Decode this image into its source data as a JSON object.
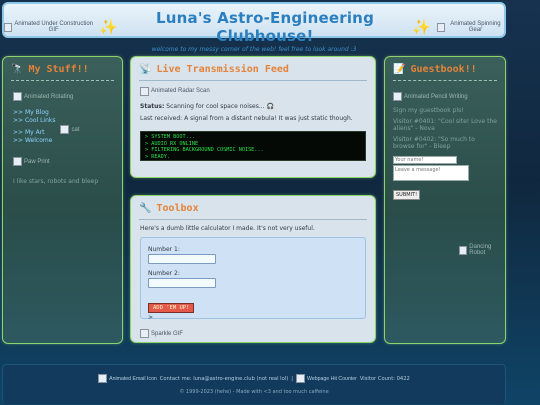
{
  "header": {
    "left_gif_alt": "Animated Under Construction GIF",
    "right_gif_alt": "Animated Spinning Gear",
    "title": "Luna's Astro-Engineering Clubhouse!",
    "sparkle": "✨",
    "subtitle": "welcome to my messy corner of the web! feel free to look around :3"
  },
  "left": {
    "icon": "🔭",
    "title": "My Stuff!!",
    "image_alt": "Animated Rotating",
    "links": [
      ">> My Blog",
      ">> Cool Links",
      ">> My Art",
      ">> Welcome"
    ],
    "inline_img_alt": "cat",
    "paw_alt": "Paw Print",
    "note": "I like stars, robots and bleep"
  },
  "feed": {
    "icon": "📡",
    "title": "Live Transmission Feed",
    "radar_alt": "Animated Radar Scan",
    "status_label": "Status:",
    "status_text": "Scanning for cool space noises...",
    "headphones": "🎧",
    "last_received": "Last received: A signal from a distant nebula! It was just static though.",
    "terminal": [
      "> SYSTEM BOOT...",
      "> AUDIO RX ONLINE",
      "> FILTERING BACKGROUND COSMIC NOISE...",
      "> READY."
    ]
  },
  "toolbox": {
    "icon": "🔧",
    "title": "Toolbox",
    "desc": "Here's a dumb little calculator I made. It's not very useful.",
    "num1_label": "Number 1:",
    "num2_label": "Number 2:",
    "button": "ADD 'EM UP!",
    "result": ">",
    "sparkle_alt": "Sparkle GIF"
  },
  "guestbook": {
    "icon": "📝",
    "title": "Guestbook!!",
    "pencil_alt": "Animated Pencil Writing",
    "subtitle": "Sign my guestbook pls!",
    "entries": [
      "Visitor #0401: \"Cool site! Love the aliens\" - Nova",
      "Visitor #0402: \"So much to browse for\" - Bleep"
    ],
    "name_placeholder": "Your name!",
    "message_placeholder": "Leave a message!",
    "submit": "SUBMIT!",
    "dancing_alt": "Dancing Robot"
  },
  "footer": {
    "email_icon_alt": "Animated Email Icon",
    "contact_text": "Contact me: luna@astro-engine.club (not real lol)",
    "counter_alt": "Webpage Hit Counter",
    "visitor_text": "Visitor Count: 0422",
    "copyright": "© 1999-2023 (hehe) - Made with <3 and too much caffeine"
  },
  "colors": {
    "panel_border": "#8bd36b",
    "title_orange": "#e5833a",
    "header_blue": "#2c7fbf",
    "terminal_green": "#29e44a",
    "calc_button": "#e35a4b"
  }
}
